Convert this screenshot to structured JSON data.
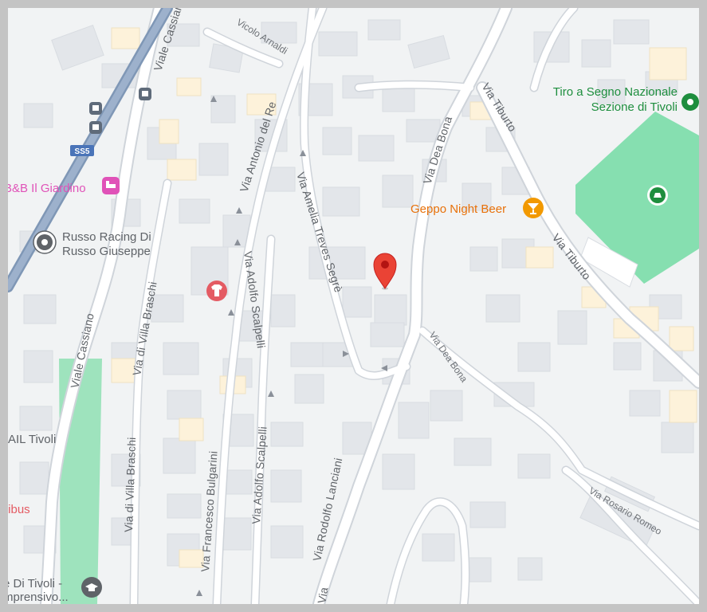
{
  "colors": {
    "map_bg": "#f1f3f4",
    "building": "#e3e6ea",
    "building_accent": "#fdf3dc",
    "road": "#ffffff",
    "road_outline": "#d5d9de",
    "highway": "#8fa6c3",
    "park": "#7cdaa5",
    "pin": "#ea4335",
    "poi_pink": "#e052b8",
    "poi_orange": "#e8710a",
    "poi_green": "#1e8e3e",
    "poi_gray": "#5f6368"
  },
  "streets": {
    "viale_cassiano_top": "Viale Cassiano",
    "vicolo_arnaldi": "Vicolo Arnaldi",
    "via_antonio_del_re": "Via Antonio del Re",
    "via_amelia_treves_segre": "Via Amelia Treves Segrè",
    "via_dea_bona_top": "Via Dea Bona",
    "via_tiburto_top": "Via Tiburto",
    "via_tiburto_mid": "Via Tiburto",
    "via_dea_bona_mid": "Via Dea Bona",
    "via_di_villa_braschi_top": "Via di Villa Braschi",
    "via_di_villa_braschi_bottom": "Via di Villa Braschi",
    "viale_cassiano_left": "Viale Cassiano",
    "via_adolfo_scalpelli_top": "Via Adolfo Scalpelli",
    "via_adolfo_scalpelli_bottom": "Via Adolfo Scalpelli",
    "via_francesco_bulgarini": "Via Francesco Bulgarini",
    "via_rodolfo_lanciani": "Via Rodolfo Lanciani",
    "via_rosario_romeo": "Via Rosario Romeo",
    "via_bottom_cut": "Via",
    "route_shield": "SS5"
  },
  "pois": {
    "bnb": "B&B Il Giardino",
    "russo_line1": "Russo Racing Di",
    "russo_line2": "Russo Giuseppe",
    "geppo": "Geppo Night Beer",
    "tiro_line1": "Tiro a Segno Nazionale",
    "tiro_line2": "Sezione di Tivoli",
    "ail": "AIL Tivoli",
    "tibus": "tibus",
    "school_line1": "e Di Tivoli -",
    "school_line2": "mprensivo..."
  },
  "icons": {
    "bus_stops": "bus-stop-icon",
    "bnb": "bed-icon",
    "russo": "place-icon",
    "geppo": "cocktail-icon",
    "tiro": "place-icon",
    "park_poi": "sports-icon",
    "shop": "clothing-shop-icon",
    "school": "school-icon",
    "pin": "location-pin-icon"
  }
}
